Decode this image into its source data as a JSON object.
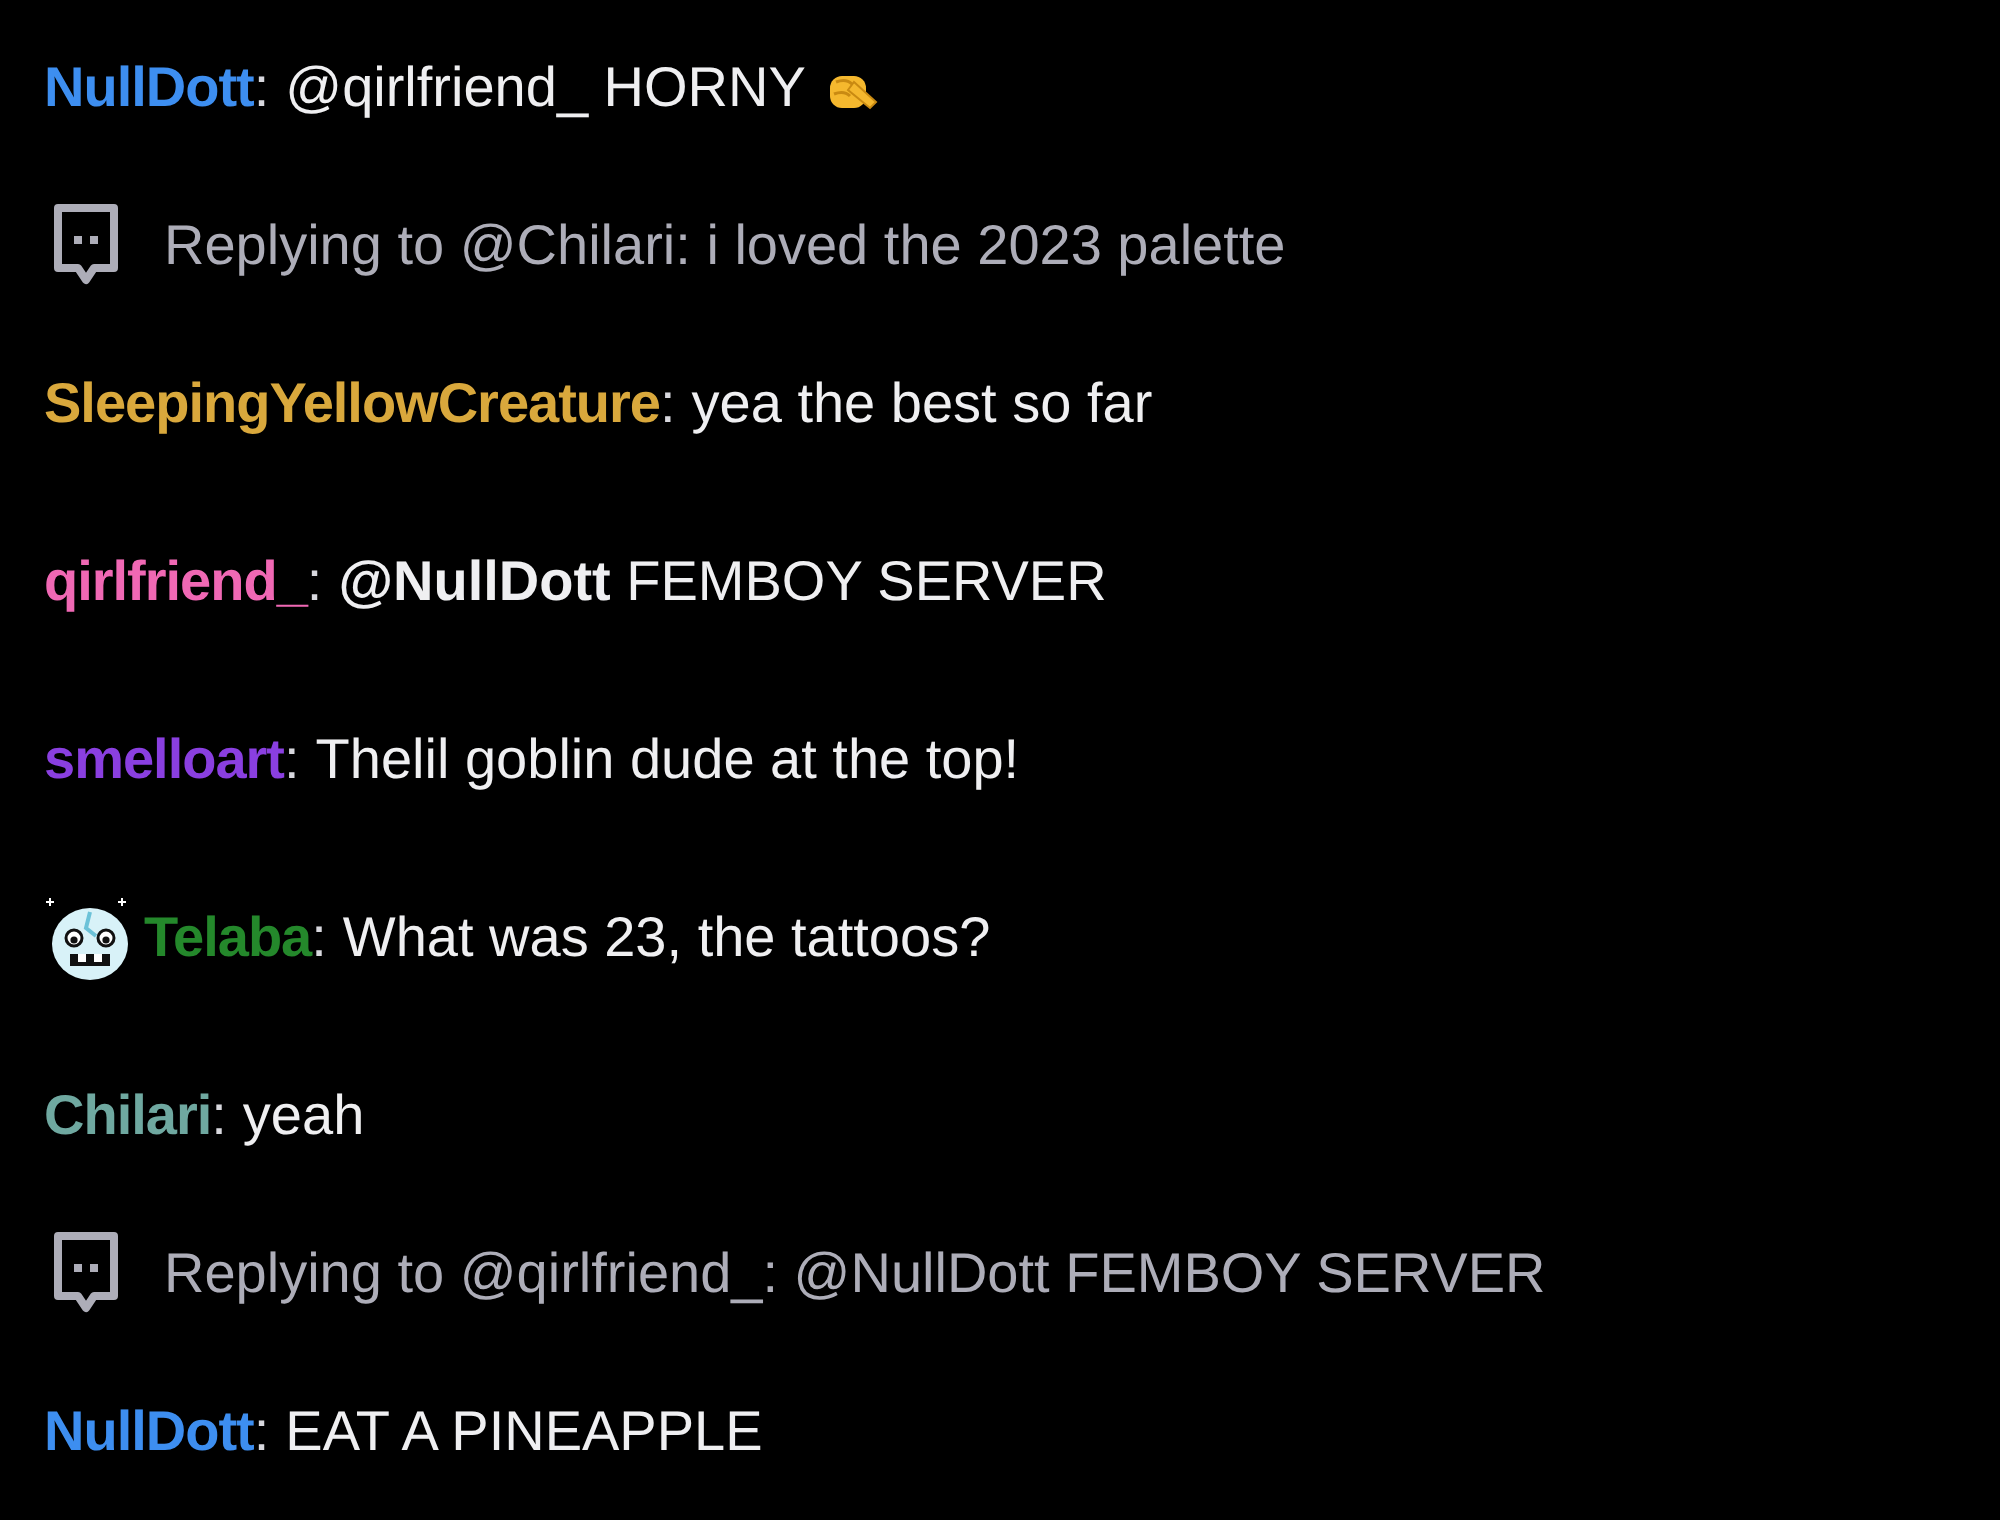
{
  "chat": [
    {
      "kind": "message",
      "username": "NullDott",
      "color": "#3d8ef0",
      "separator": ":",
      "text": "@qirlfriend_ HORNY",
      "badge": false,
      "trailing_emoji": true
    },
    {
      "kind": "reply",
      "text": "Replying to @Chilari: i loved the 2023 palette"
    },
    {
      "kind": "message",
      "username": "SleepingYellowCreature",
      "color": "#d9a83c",
      "separator": ":",
      "text": "yea the best so far",
      "badge": false,
      "trailing_emoji": false
    },
    {
      "kind": "message",
      "username": "qirlfriend_",
      "color": "#f068b4",
      "separator": ":",
      "text": "**@NullDott** FEMBOY SERVER",
      "badge": false,
      "trailing_emoji": false
    },
    {
      "kind": "message",
      "username": "smelloart",
      "color": "#8a3fe0",
      "separator": ":",
      "text": "Thelil goblin dude at the top!",
      "badge": false,
      "trailing_emoji": false
    },
    {
      "kind": "message",
      "username": "Telaba",
      "color": "#24882b",
      "separator": ":",
      "text": "What was 23, the tattoos?",
      "badge": true,
      "trailing_emoji": false
    },
    {
      "kind": "message",
      "username": "Chilari",
      "color": "#6fa8a0",
      "separator": ":",
      "text": "yeah",
      "badge": false,
      "trailing_emoji": false
    },
    {
      "kind": "reply",
      "text": "Replying to @qirlfriend_: @NullDott FEMBOY SERVER"
    },
    {
      "kind": "message",
      "username": "NullDott",
      "color": "#3d8ef0",
      "separator": ":",
      "text": "EAT A PINEAPPLE",
      "badge": false,
      "trailing_emoji": false
    }
  ]
}
